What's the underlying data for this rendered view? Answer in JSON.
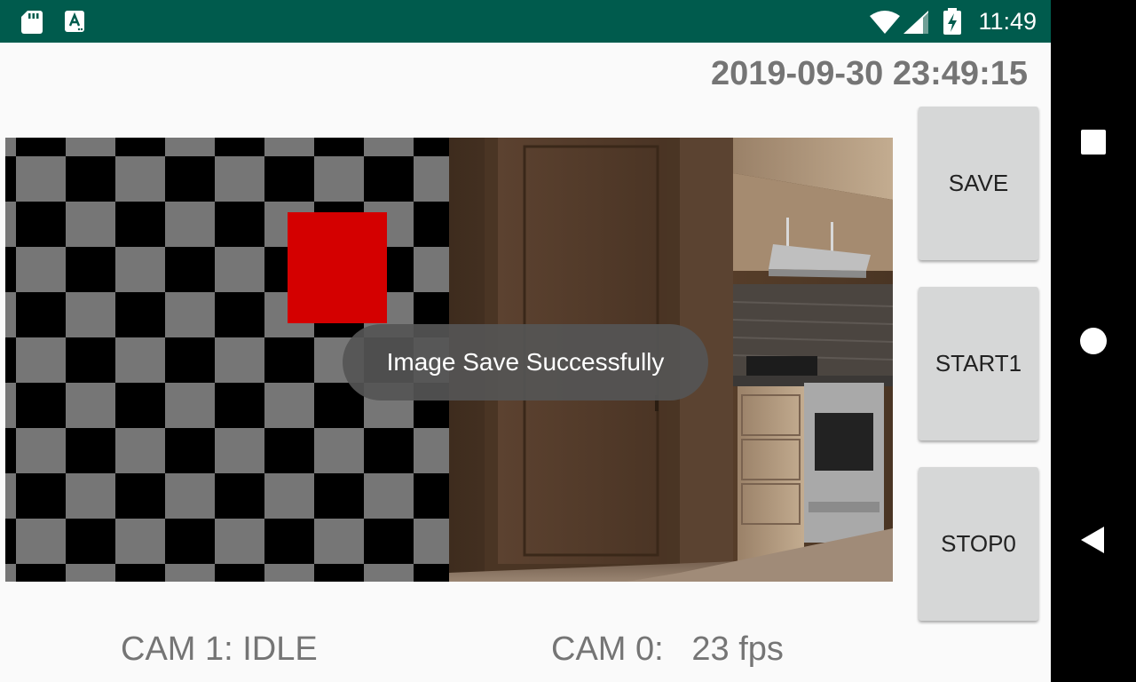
{
  "status_bar": {
    "time": "11:49",
    "icons": [
      "sd-card-icon",
      "keyboard-a-icon",
      "wifi-icon",
      "cell-signal-icon",
      "battery-charging-icon"
    ],
    "background": "#005b4d"
  },
  "header": {
    "datetime": "2019-09-30 23:49:15"
  },
  "cameras": {
    "cam1": {
      "status_text": "CAM 1: IDLE"
    },
    "cam0": {
      "status_text": "CAM 0:   23 fps"
    }
  },
  "buttons": {
    "save_label": "SAVE",
    "start_label": "START1",
    "stop_label": "STOP0"
  },
  "toast": {
    "message": "Image Save Successfully"
  },
  "nav_bar": {
    "icons": [
      "recents-square-icon",
      "home-circle-icon",
      "back-triangle-icon"
    ]
  },
  "colors": {
    "checker_dark": "#000000",
    "checker_light": "#767676",
    "marker_red": "#d40000",
    "button_bg": "#d6d7d7",
    "text_gray": "#757575"
  }
}
